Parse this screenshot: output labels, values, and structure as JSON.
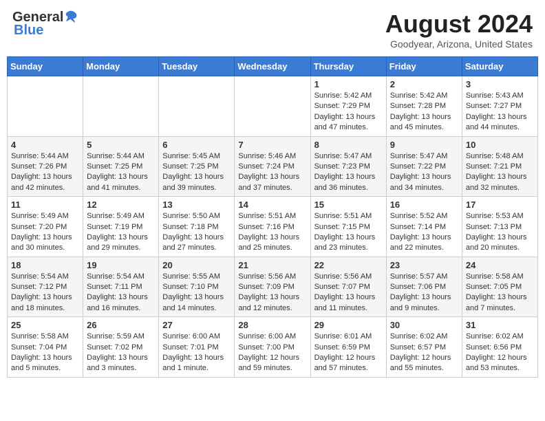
{
  "header": {
    "logo_general": "General",
    "logo_blue": "Blue",
    "month": "August 2024",
    "location": "Goodyear, Arizona, United States"
  },
  "weekdays": [
    "Sunday",
    "Monday",
    "Tuesday",
    "Wednesday",
    "Thursday",
    "Friday",
    "Saturday"
  ],
  "weeks": [
    [
      {
        "day": "",
        "sunrise": "",
        "sunset": "",
        "daylight": ""
      },
      {
        "day": "",
        "sunrise": "",
        "sunset": "",
        "daylight": ""
      },
      {
        "day": "",
        "sunrise": "",
        "sunset": "",
        "daylight": ""
      },
      {
        "day": "",
        "sunrise": "",
        "sunset": "",
        "daylight": ""
      },
      {
        "day": "1",
        "sunrise": "Sunrise: 5:42 AM",
        "sunset": "Sunset: 7:29 PM",
        "daylight": "Daylight: 13 hours and 47 minutes."
      },
      {
        "day": "2",
        "sunrise": "Sunrise: 5:42 AM",
        "sunset": "Sunset: 7:28 PM",
        "daylight": "Daylight: 13 hours and 45 minutes."
      },
      {
        "day": "3",
        "sunrise": "Sunrise: 5:43 AM",
        "sunset": "Sunset: 7:27 PM",
        "daylight": "Daylight: 13 hours and 44 minutes."
      }
    ],
    [
      {
        "day": "4",
        "sunrise": "Sunrise: 5:44 AM",
        "sunset": "Sunset: 7:26 PM",
        "daylight": "Daylight: 13 hours and 42 minutes."
      },
      {
        "day": "5",
        "sunrise": "Sunrise: 5:44 AM",
        "sunset": "Sunset: 7:25 PM",
        "daylight": "Daylight: 13 hours and 41 minutes."
      },
      {
        "day": "6",
        "sunrise": "Sunrise: 5:45 AM",
        "sunset": "Sunset: 7:25 PM",
        "daylight": "Daylight: 13 hours and 39 minutes."
      },
      {
        "day": "7",
        "sunrise": "Sunrise: 5:46 AM",
        "sunset": "Sunset: 7:24 PM",
        "daylight": "Daylight: 13 hours and 37 minutes."
      },
      {
        "day": "8",
        "sunrise": "Sunrise: 5:47 AM",
        "sunset": "Sunset: 7:23 PM",
        "daylight": "Daylight: 13 hours and 36 minutes."
      },
      {
        "day": "9",
        "sunrise": "Sunrise: 5:47 AM",
        "sunset": "Sunset: 7:22 PM",
        "daylight": "Daylight: 13 hours and 34 minutes."
      },
      {
        "day": "10",
        "sunrise": "Sunrise: 5:48 AM",
        "sunset": "Sunset: 7:21 PM",
        "daylight": "Daylight: 13 hours and 32 minutes."
      }
    ],
    [
      {
        "day": "11",
        "sunrise": "Sunrise: 5:49 AM",
        "sunset": "Sunset: 7:20 PM",
        "daylight": "Daylight: 13 hours and 30 minutes."
      },
      {
        "day": "12",
        "sunrise": "Sunrise: 5:49 AM",
        "sunset": "Sunset: 7:19 PM",
        "daylight": "Daylight: 13 hours and 29 minutes."
      },
      {
        "day": "13",
        "sunrise": "Sunrise: 5:50 AM",
        "sunset": "Sunset: 7:18 PM",
        "daylight": "Daylight: 13 hours and 27 minutes."
      },
      {
        "day": "14",
        "sunrise": "Sunrise: 5:51 AM",
        "sunset": "Sunset: 7:16 PM",
        "daylight": "Daylight: 13 hours and 25 minutes."
      },
      {
        "day": "15",
        "sunrise": "Sunrise: 5:51 AM",
        "sunset": "Sunset: 7:15 PM",
        "daylight": "Daylight: 13 hours and 23 minutes."
      },
      {
        "day": "16",
        "sunrise": "Sunrise: 5:52 AM",
        "sunset": "Sunset: 7:14 PM",
        "daylight": "Daylight: 13 hours and 22 minutes."
      },
      {
        "day": "17",
        "sunrise": "Sunrise: 5:53 AM",
        "sunset": "Sunset: 7:13 PM",
        "daylight": "Daylight: 13 hours and 20 minutes."
      }
    ],
    [
      {
        "day": "18",
        "sunrise": "Sunrise: 5:54 AM",
        "sunset": "Sunset: 7:12 PM",
        "daylight": "Daylight: 13 hours and 18 minutes."
      },
      {
        "day": "19",
        "sunrise": "Sunrise: 5:54 AM",
        "sunset": "Sunset: 7:11 PM",
        "daylight": "Daylight: 13 hours and 16 minutes."
      },
      {
        "day": "20",
        "sunrise": "Sunrise: 5:55 AM",
        "sunset": "Sunset: 7:10 PM",
        "daylight": "Daylight: 13 hours and 14 minutes."
      },
      {
        "day": "21",
        "sunrise": "Sunrise: 5:56 AM",
        "sunset": "Sunset: 7:09 PM",
        "daylight": "Daylight: 13 hours and 12 minutes."
      },
      {
        "day": "22",
        "sunrise": "Sunrise: 5:56 AM",
        "sunset": "Sunset: 7:07 PM",
        "daylight": "Daylight: 13 hours and 11 minutes."
      },
      {
        "day": "23",
        "sunrise": "Sunrise: 5:57 AM",
        "sunset": "Sunset: 7:06 PM",
        "daylight": "Daylight: 13 hours and 9 minutes."
      },
      {
        "day": "24",
        "sunrise": "Sunrise: 5:58 AM",
        "sunset": "Sunset: 7:05 PM",
        "daylight": "Daylight: 13 hours and 7 minutes."
      }
    ],
    [
      {
        "day": "25",
        "sunrise": "Sunrise: 5:58 AM",
        "sunset": "Sunset: 7:04 PM",
        "daylight": "Daylight: 13 hours and 5 minutes."
      },
      {
        "day": "26",
        "sunrise": "Sunrise: 5:59 AM",
        "sunset": "Sunset: 7:02 PM",
        "daylight": "Daylight: 13 hours and 3 minutes."
      },
      {
        "day": "27",
        "sunrise": "Sunrise: 6:00 AM",
        "sunset": "Sunset: 7:01 PM",
        "daylight": "Daylight: 13 hours and 1 minute."
      },
      {
        "day": "28",
        "sunrise": "Sunrise: 6:00 AM",
        "sunset": "Sunset: 7:00 PM",
        "daylight": "Daylight: 12 hours and 59 minutes."
      },
      {
        "day": "29",
        "sunrise": "Sunrise: 6:01 AM",
        "sunset": "Sunset: 6:59 PM",
        "daylight": "Daylight: 12 hours and 57 minutes."
      },
      {
        "day": "30",
        "sunrise": "Sunrise: 6:02 AM",
        "sunset": "Sunset: 6:57 PM",
        "daylight": "Daylight: 12 hours and 55 minutes."
      },
      {
        "day": "31",
        "sunrise": "Sunrise: 6:02 AM",
        "sunset": "Sunset: 6:56 PM",
        "daylight": "Daylight: 12 hours and 53 minutes."
      }
    ]
  ]
}
